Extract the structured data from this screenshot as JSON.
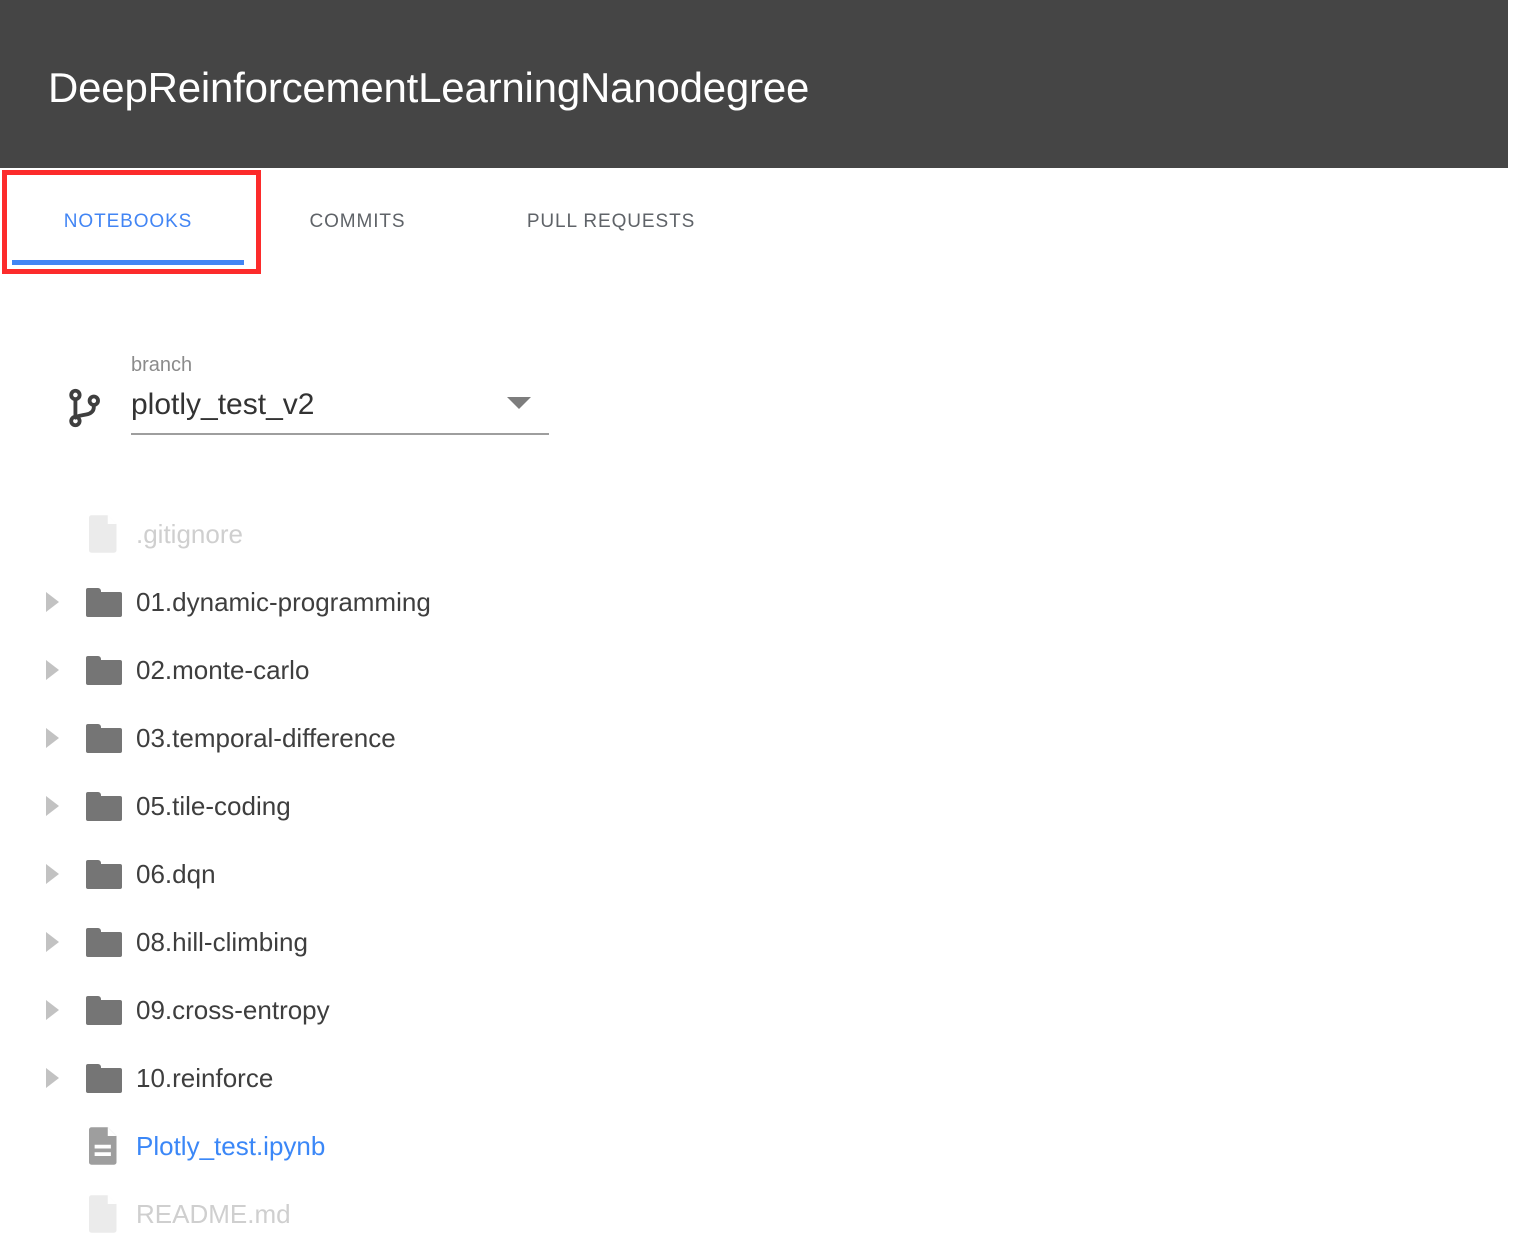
{
  "header": {
    "title": "DeepReinforcementLearningNanodegree",
    "background_color": "#454545",
    "text_color": "#ffffff"
  },
  "tabs": {
    "active_index": 0,
    "accent_color": "#4285f4",
    "items": [
      {
        "label": "NOTEBOOKS",
        "active": true
      },
      {
        "label": "COMMITS",
        "active": false
      },
      {
        "label": "PULL REQUESTS",
        "active": false
      }
    ]
  },
  "annotation": {
    "highlight_color": "#fc2b2b",
    "target": "NOTEBOOKS"
  },
  "branch_selector": {
    "icon": "git-branch-icon",
    "label": "branch",
    "value": "plotly_test_v2",
    "dropdown_icon": "chevron-down-icon"
  },
  "file_tree": {
    "items": [
      {
        "name": ".gitignore",
        "type": "file",
        "icon": "file-icon",
        "state": "disabled",
        "expandable": false
      },
      {
        "name": "01.dynamic-programming",
        "type": "folder",
        "icon": "folder-icon",
        "state": "normal",
        "expandable": true
      },
      {
        "name": "02.monte-carlo",
        "type": "folder",
        "icon": "folder-icon",
        "state": "normal",
        "expandable": true
      },
      {
        "name": "03.temporal-difference",
        "type": "folder",
        "icon": "folder-icon",
        "state": "normal",
        "expandable": true
      },
      {
        "name": "05.tile-coding",
        "type": "folder",
        "icon": "folder-icon",
        "state": "normal",
        "expandable": true
      },
      {
        "name": "06.dqn",
        "type": "folder",
        "icon": "folder-icon",
        "state": "normal",
        "expandable": true
      },
      {
        "name": "08.hill-climbing",
        "type": "folder",
        "icon": "folder-icon",
        "state": "normal",
        "expandable": true
      },
      {
        "name": "09.cross-entropy",
        "type": "folder",
        "icon": "folder-icon",
        "state": "normal",
        "expandable": true
      },
      {
        "name": "10.reinforce",
        "type": "folder",
        "icon": "folder-icon",
        "state": "normal",
        "expandable": true
      },
      {
        "name": "Plotly_test.ipynb",
        "type": "notebook",
        "icon": "notebook-icon",
        "state": "link",
        "expandable": false
      },
      {
        "name": "README.md",
        "type": "file",
        "icon": "file-icon",
        "state": "disabled",
        "expandable": false
      }
    ]
  }
}
